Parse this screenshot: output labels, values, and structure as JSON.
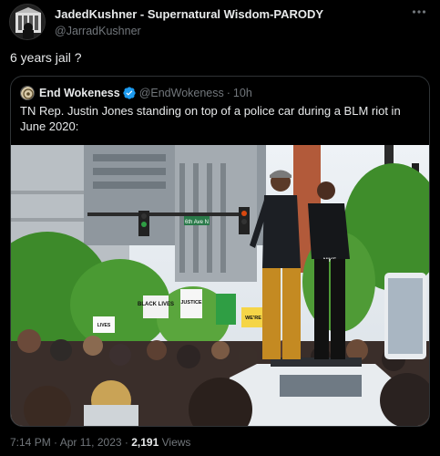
{
  "tweet": {
    "display_name": "JadedKushner - Supernatural Wisdom-PARODY",
    "handle": "@JarradKushner",
    "more_icon": "more-dots-icon",
    "text": "6 years jail ?"
  },
  "quoted": {
    "display_name": "End Wokeness",
    "handle": "@EndWokeness",
    "separator": "·",
    "time": "10h",
    "text": "TN Rep. Justin Jones standing on top of a police car during a BLM riot in June 2020:",
    "photo": {
      "sign_black_lives": "BLACK LIVES",
      "sign_justice": "JUSTICE",
      "sign_were": "WE'RE",
      "shirt_nike": "NIKE",
      "street_sign": "6th Ave N",
      "sign_lives": "LIVES"
    }
  },
  "footer": {
    "time": "7:14 PM",
    "dot1": "·",
    "date": "Apr 11, 2023",
    "dot2": "·",
    "views_count": "2,191",
    "views_label": "Views"
  },
  "colors": {
    "background": "#000000",
    "text": "#e7e9ea",
    "secondary": "#71767b",
    "border": "#2f3336",
    "verified": "#1d9bf0"
  }
}
